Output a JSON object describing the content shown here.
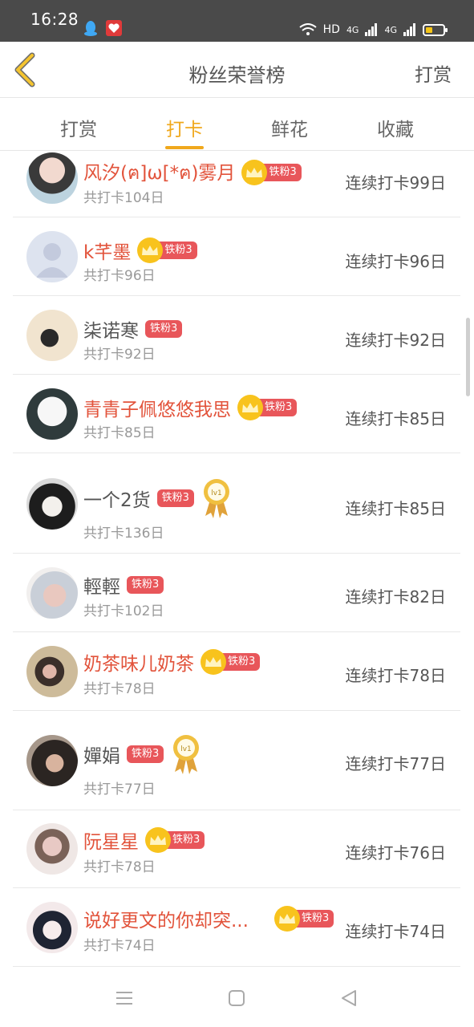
{
  "status": {
    "time": "16:28",
    "net": "HD",
    "sig1": "4G",
    "sig2": "4G"
  },
  "header": {
    "title": "粉丝荣誉榜",
    "right": "打赏"
  },
  "tabs": [
    {
      "label": "打赏"
    },
    {
      "label": "打卡"
    },
    {
      "label": "鲜花"
    },
    {
      "label": "收藏"
    }
  ],
  "badge_text": "铁粉3",
  "medal_text": "lv1",
  "rows": [
    {
      "name": "风汐(ฅ]ω[*ฅ)雾月",
      "total": "共打卡104日",
      "streak": "连续打卡99日"
    },
    {
      "name": "k芊墨",
      "total": "共打卡96日",
      "streak": "连续打卡96日"
    },
    {
      "name": "柒诺寒",
      "total": "共打卡92日",
      "streak": "连续打卡92日"
    },
    {
      "name": "青青子佩悠悠我思",
      "total": "共打卡85日",
      "streak": "连续打卡85日"
    },
    {
      "name": "一个2货",
      "total": "共打卡136日",
      "streak": "连续打卡85日"
    },
    {
      "name": "輕輕",
      "total": "共打卡102日",
      "streak": "连续打卡82日"
    },
    {
      "name": "奶茶味儿奶茶",
      "total": "共打卡78日",
      "streak": "连续打卡78日"
    },
    {
      "name": "嬋娟",
      "total": "共打卡77日",
      "streak": "连续打卡77日"
    },
    {
      "name": "阮星星",
      "total": "共打卡78日",
      "streak": "连续打卡76日"
    },
    {
      "name": "说好更文的你却突...",
      "total": "共打卡74日",
      "streak": "连续打卡74日"
    }
  ]
}
